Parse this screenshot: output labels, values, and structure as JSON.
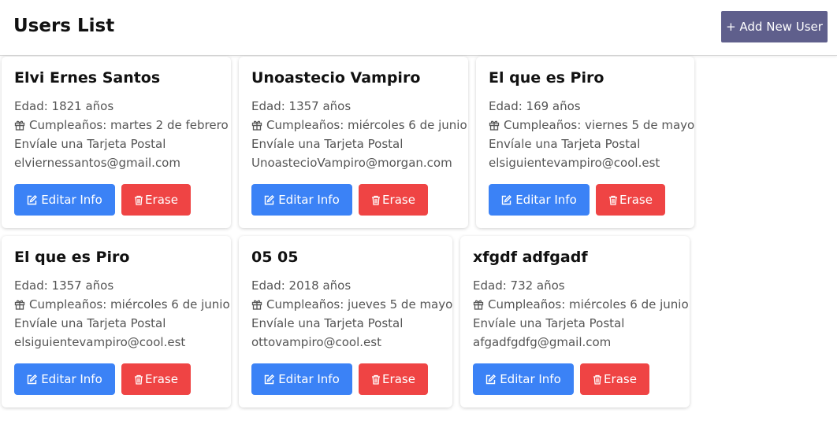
{
  "header": {
    "title": "Users List",
    "add_button_label": "+ Add New User"
  },
  "users": [
    {
      "name": "Elvi Ernes Santos",
      "age": "Edad: 1821 años",
      "birthday": "Cumpleaños: martes 2 de febrero",
      "postcard": "Envíale una Tarjeta Postal",
      "email": "elviernessantos@gmail.com",
      "edit_label": "Editar Info",
      "erase_label": "Erase"
    },
    {
      "name": "Unoastecio Vampiro",
      "age": "Edad: 1357 años",
      "birthday": "Cumpleaños: miércoles 6 de junio",
      "postcard": "Envíale una Tarjeta Postal",
      "email": "UnoastecioVampiro@morgan.com",
      "edit_label": "Editar Info",
      "erase_label": "Erase"
    },
    {
      "name": "El que es Piro",
      "age": "Edad: 169 años",
      "birthday": "Cumpleaños: viernes 5 de mayo",
      "postcard": "Envíale una Tarjeta Postal",
      "email": "elsiguientevampiro@cool.est",
      "edit_label": "Editar Info",
      "erase_label": "Erase"
    },
    {
      "name": "El que es Piro",
      "age": "Edad: 1357 años",
      "birthday": "Cumpleaños: miércoles 6 de junio",
      "postcard": "Envíale una Tarjeta Postal",
      "email": "elsiguientevampiro@cool.est",
      "edit_label": "Editar Info",
      "erase_label": "Erase"
    },
    {
      "name": "05 05",
      "age": "Edad: 2018 años",
      "birthday": "Cumpleaños: jueves 5 de mayo",
      "postcard": "Envíale una Tarjeta Postal",
      "email": "ottovampiro@cool.est",
      "edit_label": "Editar Info",
      "erase_label": "Erase"
    },
    {
      "name": "xfgdf adfgadf",
      "age": "Edad: 732 años",
      "birthday": "Cumpleaños: miércoles 6 de junio",
      "postcard": "Envíale una Tarjeta Postal",
      "email": "afgadfgdfg@gmail.com",
      "edit_label": "Editar Info",
      "erase_label": "Erase"
    }
  ],
  "icons": {
    "birthday": "gift-icon",
    "edit": "edit-icon",
    "erase": "trash-icon"
  },
  "colors": {
    "add_button": "#5f5f8c",
    "edit_button": "#3b82f6",
    "erase_button": "#ef4444"
  }
}
